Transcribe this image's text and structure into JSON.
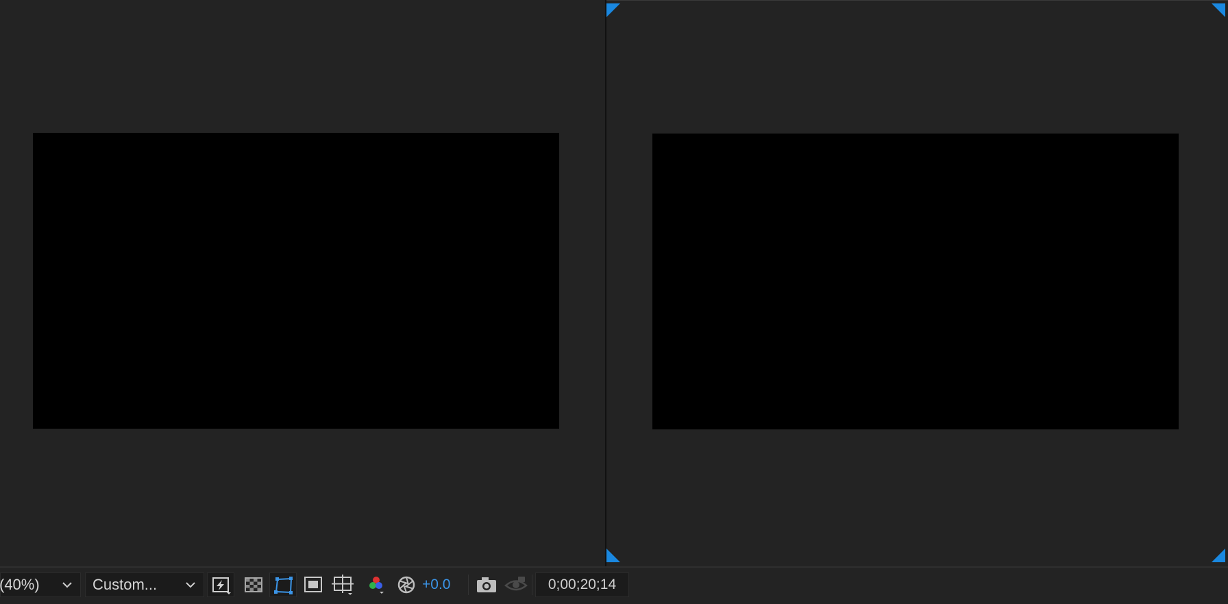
{
  "colors": {
    "panel_bg": "#232323",
    "frame_bg": "#000000",
    "accent_blue": "#1a88e0",
    "exposure_text": "#3b95e8",
    "text": "#d6d6d6"
  },
  "left_viewer": {
    "frame": "black-composition-frame"
  },
  "right_viewer": {
    "frame": "black-composition-frame",
    "active_indicator": "blue-corner-brackets"
  },
  "toolbar": {
    "magnification": {
      "value": "(40%)",
      "icon": "chevron-down-icon"
    },
    "resolution": {
      "value": "Custom...",
      "icon": "chevron-down-icon"
    },
    "buttons": [
      {
        "name": "fast-previews-icon",
        "active": false
      },
      {
        "name": "transparency-grid-icon",
        "active": false
      },
      {
        "name": "mask-path-visibility-icon",
        "active": true
      },
      {
        "name": "region-of-interest-icon",
        "active": false
      },
      {
        "name": "grid-guides-icon",
        "active": false
      },
      {
        "name": "color-channels-icon",
        "active": false
      },
      {
        "name": "exposure-reset-icon",
        "active": false
      }
    ],
    "exposure_value": "+0.0",
    "snapshot_icon": "camera-icon",
    "show_snapshot_icon": "show-snapshot-icon",
    "timecode": "0;00;20;14"
  }
}
